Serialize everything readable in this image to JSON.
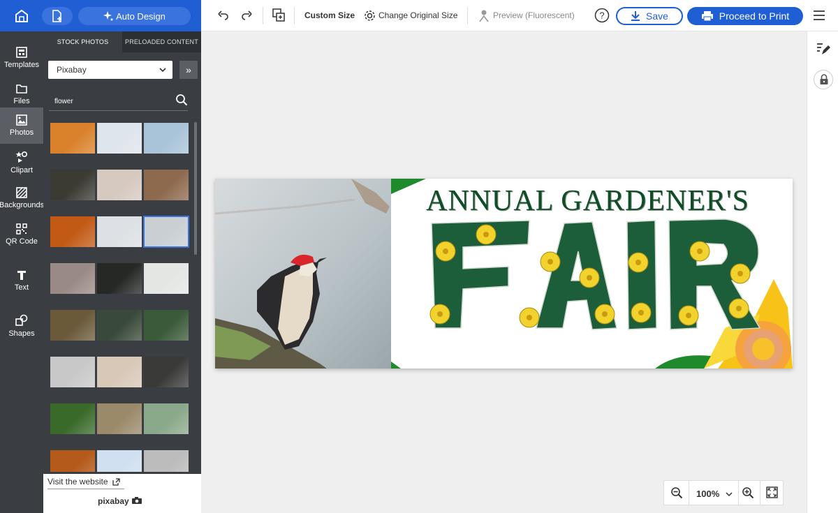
{
  "header": {
    "auto_design_label": "Auto Design"
  },
  "rail": {
    "items": [
      {
        "label": "Templates",
        "icon": "templates-icon"
      },
      {
        "label": "Files",
        "icon": "folder-icon"
      },
      {
        "label": "Photos",
        "icon": "photo-icon"
      },
      {
        "label": "Clipart",
        "icon": "clipart-icon"
      },
      {
        "label": "Backgrounds",
        "icon": "backgrounds-icon"
      },
      {
        "label": "QR Code",
        "icon": "qr-code-icon"
      },
      {
        "label": "Text",
        "icon": "text-icon"
      },
      {
        "label": "Shapes",
        "icon": "shapes-icon"
      }
    ],
    "active": "Photos"
  },
  "panel": {
    "tabs": [
      {
        "label": "STOCK PHOTOS"
      },
      {
        "label": "PRELOADED CONTENT"
      }
    ],
    "source": {
      "selected": "Pixabay"
    },
    "search": {
      "value": "flower"
    },
    "footer": {
      "visit_label": "Visit the website",
      "logo_text": "pixabay"
    },
    "thumbnail_colors": [
      [
        "#d9812b",
        "#dfe5ec",
        "#a9c3d8"
      ],
      [
        "#3b3a33",
        "#d5c9c0",
        "#8d6a4e"
      ],
      [
        "#c25a16",
        "#dde0e4",
        "#c9cfd3"
      ],
      [
        "#9a8a86",
        "#262826",
        "#e4e6e4"
      ],
      [
        "#6a5a3a",
        "#3a4a3a",
        "#3a5a3a"
      ],
      [
        "#c8c8c8",
        "#d8c8b8",
        "#3a3a38"
      ],
      [
        "#3a6a2a",
        "#9a8a6a",
        "#8aa88a"
      ],
      [
        "#b45a1a",
        "#d0e0f0",
        "#bcbcbc"
      ]
    ]
  },
  "toolbar": {
    "custom_size": "Custom Size",
    "change_size": "Change Original Size",
    "preview": "Preview (Fluorescent)",
    "save": "Save",
    "print": "Proceed to Print"
  },
  "design": {
    "headline": "ANNUAL GARDENER'S",
    "big_word": "FAIR",
    "colors": {
      "headline": "#0f4d26",
      "leaves": "#1c5e3a",
      "flowers": "#f2d22c",
      "sunflower": "#f7c318"
    }
  },
  "zoom": {
    "value": "100%"
  },
  "colors": {
    "brand_blue": "#1f5fd3",
    "rail_dark": "#3a3d42"
  }
}
